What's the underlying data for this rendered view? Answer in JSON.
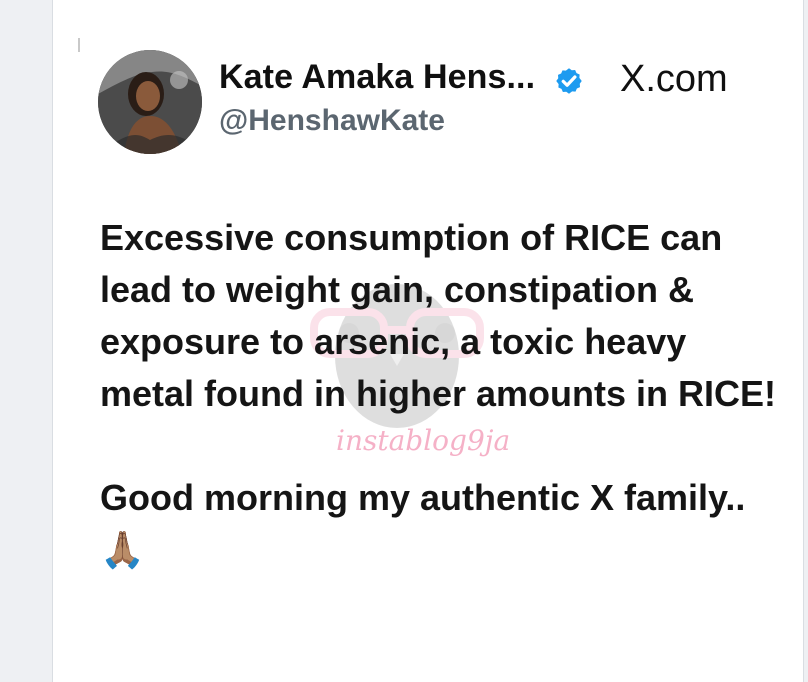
{
  "tweet": {
    "display_name": "Kate Amaka Hens...",
    "handle": "@HenshawKate",
    "site": "X.com",
    "verified_icon": "verified-badge-icon",
    "avatar_icon": "profile-photo",
    "paragraphs": [
      "Excessive consumption of RICE can lead to weight gain, constipation & exposure to arsenic, a toxic heavy metal found in higher amounts in RICE!",
      "Good morning my authentic X family..🙏🏽"
    ]
  },
  "watermark": {
    "text": "instablog9ja",
    "icon": "owl-logo"
  },
  "colors": {
    "verified": "#1d9bf0",
    "handle": "#5b6670",
    "text": "#151515",
    "watermark": "#f4a9c1"
  }
}
